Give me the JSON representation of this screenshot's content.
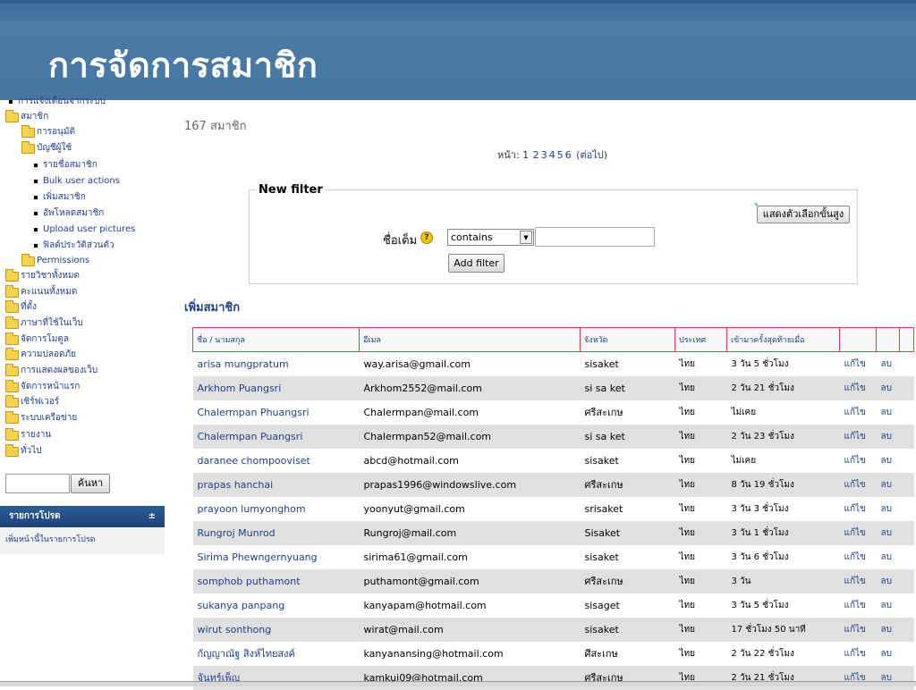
{
  "banner": {
    "title": "การจัดการสมาชิก"
  },
  "nav": {
    "items": [
      {
        "label": "การแจ้งเตือนจากระบบ",
        "type": "bullet",
        "indent": 0
      },
      {
        "label": "สมาชิก",
        "type": "folder",
        "indent": 0
      },
      {
        "label": "การอนุมัติ",
        "type": "folder",
        "indent": 1
      },
      {
        "label": "บัญชีผู้ใช้",
        "type": "folder",
        "indent": 1
      },
      {
        "label": "รายชื่อสมาชิก",
        "type": "bullet",
        "indent": 2
      },
      {
        "label": "Bulk user actions",
        "type": "bullet",
        "indent": 2
      },
      {
        "label": "เพิ่มสมาชิก",
        "type": "bullet",
        "indent": 2
      },
      {
        "label": "อัพโหลดสมาชิก",
        "type": "bullet",
        "indent": 2
      },
      {
        "label": "Upload user pictures",
        "type": "bullet",
        "indent": 2
      },
      {
        "label": "ฟิลด์ประวัติส่วนตัว",
        "type": "bullet",
        "indent": 2
      },
      {
        "label": "Permissions",
        "type": "folder",
        "indent": 1
      },
      {
        "label": "รายวิชาทั้งหมด",
        "type": "folder",
        "indent": 0
      },
      {
        "label": "คะแนนทั้งหมด",
        "type": "folder",
        "indent": 0
      },
      {
        "label": "ที่ตั้ง",
        "type": "folder",
        "indent": 0
      },
      {
        "label": "ภาษาที่ใช้ในเว็บ",
        "type": "folder",
        "indent": 0
      },
      {
        "label": "จัดการโมดูล",
        "type": "folder",
        "indent": 0
      },
      {
        "label": "ความปลอดภัย",
        "type": "folder",
        "indent": 0
      },
      {
        "label": "การแสดงผลของเว็บ",
        "type": "folder",
        "indent": 0
      },
      {
        "label": "จัดการหน้าแรก",
        "type": "folder",
        "indent": 0
      },
      {
        "label": "เซิร์ฟเวอร์",
        "type": "folder",
        "indent": 0
      },
      {
        "label": "ระบบเครือข่าย",
        "type": "folder",
        "indent": 0
      },
      {
        "label": "รายงาน",
        "type": "folder",
        "indent": 0
      },
      {
        "label": "ทั่วไป",
        "type": "folder",
        "indent": 0
      }
    ],
    "search_button": "ค้นหา",
    "bookmarks_header": "รายการโปรด",
    "bookmarks_toggle": "±",
    "bookmarks_link": "เพิ่มหน้านี้ในรายการโปรด"
  },
  "main": {
    "member_count": "167 สมาชิก",
    "paging": {
      "prefix": "หน้า:",
      "current": "1",
      "pages": [
        "2",
        "3",
        "4",
        "5",
        "6"
      ],
      "next": "(ต่อไป)"
    },
    "filter": {
      "legend": "New filter",
      "advanced_button": "แสดงตัวเลือกขั้นสูง",
      "advanced_star": "*",
      "field_label": "ชื่อเต็ม",
      "help_icon": "?",
      "operator": "contains",
      "value": "",
      "add_button": "Add filter"
    },
    "add_member_link": "เพิ่มสมาชิก",
    "table": {
      "headers": [
        "ชื่อ / นามสกุล",
        "อีเมล",
        "จังหวัด",
        "ประเทศ",
        "เข้ามาครั้งสุดท้ายเมื่อ",
        "",
        "",
        ""
      ],
      "edit_label": "แก้ไข",
      "delete_label": "ลบ",
      "rows": [
        {
          "name": "arisa mungpratum",
          "email": "way.arisa@gmail.com",
          "city": "sisaket",
          "country": "ไทย",
          "last": "3 วัน 5 ชั่วโมง"
        },
        {
          "name": "Arkhom Puangsri",
          "email": "Arkhom2552@mail.com",
          "city": "si sa ket",
          "country": "ไทย",
          "last": "2 วัน 21 ชั่วโมง"
        },
        {
          "name": "Chalermpan Phuangsri",
          "email": "Chalermpan@mail.com",
          "city": "ศรีสะเกษ",
          "country": "ไทย",
          "last": "ไม่เคย"
        },
        {
          "name": "Chalermpan Puangsri",
          "email": "Chalermpan52@mail.com",
          "city": "si sa ket",
          "country": "ไทย",
          "last": "2 วัน 23 ชั่วโมง"
        },
        {
          "name": "daranee chompooviset",
          "email": "abcd@hotmail.com",
          "city": "sisaket",
          "country": "ไทย",
          "last": "ไม่เคย"
        },
        {
          "name": "prapas hanchai",
          "email": "prapas1996@windowslive.com",
          "city": "ศรีสะเกษ",
          "country": "ไทย",
          "last": "8 วัน 19 ชั่วโมง"
        },
        {
          "name": "prayoon lumyonghom",
          "email": "yoonyut@gmail.com",
          "city": "srisaket",
          "country": "ไทย",
          "last": "3 วัน 3 ชั่วโมง"
        },
        {
          "name": "Rungroj Munrod",
          "email": "Rungroj@mail.com",
          "city": "Sisaket",
          "country": "ไทย",
          "last": "3 วัน 1 ชั่วโมง"
        },
        {
          "name": "Sirima Phewngernyuang",
          "email": "sirima61@gmail.com",
          "city": "sisaket",
          "country": "ไทย",
          "last": "3 วัน 6 ชั่วโมง"
        },
        {
          "name": "somphob puthamont",
          "email": "puthamont@gmail.com",
          "city": "ศรีสะเกษ",
          "country": "ไทย",
          "last": "3 วัน"
        },
        {
          "name": "sukanya panpang",
          "email": "kanyapam@hotmail.com",
          "city": "sisaget",
          "country": "ไทย",
          "last": "3 วัน 5 ชั่วโมง"
        },
        {
          "name": "wirut sonthong",
          "email": "wirat@mail.com",
          "city": "sisaket",
          "country": "ไทย",
          "last": "17 ชั่วโมง 50 นาที"
        },
        {
          "name": "กัญญาณัฐ สิงห์ไทยสงค์",
          "email": "kanyanansing@hotmail.com",
          "city": "ศีสะเกษ",
          "country": "ไทย",
          "last": "2 วัน 22 ชั่วโมง"
        },
        {
          "name": "จันทร์เพ็ญ",
          "email": "kamkui09@hotmail.com",
          "city": "ศรีสะเกษ",
          "country": "ไทย",
          "last": "2 วัน 21 ชั่วโมง"
        }
      ]
    }
  }
}
